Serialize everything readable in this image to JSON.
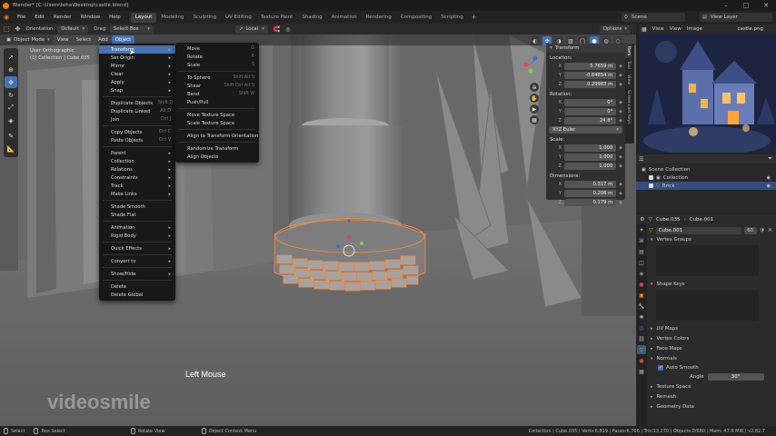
{
  "titlebar": {
    "title": "Blender* [C:\\Users\\teha\\Desktop\\castle.blend]"
  },
  "menubar": {
    "items": [
      "File",
      "Edit",
      "Render",
      "Window",
      "Help"
    ],
    "workspaces": [
      "Layout",
      "Modeling",
      "Sculpting",
      "UV Editing",
      "Texture Paint",
      "Shading",
      "Animation",
      "Rendering",
      "Compositing",
      "Scripting"
    ],
    "active_workspace": "Layout",
    "scene_label": "Scene",
    "view_layer_label": "View Layer"
  },
  "tool_header": {
    "orientation_label": "Orientation:",
    "orientation_value": "Default",
    "drag_label": "Drag:",
    "drag_value": "Select Box",
    "pivot_value": "Local",
    "options_label": "Options"
  },
  "viewport_header": {
    "mode": "Object Mode",
    "menus": [
      "View",
      "Select",
      "Add",
      "Object"
    ],
    "active_menu": "Object"
  },
  "viewport": {
    "view_name": "User Orthographic",
    "collection_info": "(1) Collection | Cube.035",
    "overlay_text": "Left Mouse",
    "watermark": "videosmile"
  },
  "object_menu": {
    "items": [
      {
        "label": "Transform",
        "shortcut": "",
        "sub": true,
        "hl": true
      },
      {
        "label": "Set Origin",
        "shortcut": "",
        "sub": true
      },
      {
        "label": "Mirror",
        "shortcut": "",
        "sub": true
      },
      {
        "label": "Clear",
        "shortcut": "",
        "sub": true
      },
      {
        "label": "Apply",
        "shortcut": "Ctrl A",
        "sub": true
      },
      {
        "label": "Snap",
        "shortcut": "",
        "sub": true
      },
      {
        "sep": true
      },
      {
        "label": "Duplicate Objects",
        "shortcut": "Shift D"
      },
      {
        "label": "Duplicate Linked",
        "shortcut": "Alt D"
      },
      {
        "label": "Join",
        "shortcut": "Ctrl J"
      },
      {
        "sep": true
      },
      {
        "label": "Copy Objects",
        "shortcut": "Ctrl C"
      },
      {
        "label": "Paste Objects",
        "shortcut": "Ctrl V"
      },
      {
        "sep": true
      },
      {
        "label": "Parent",
        "shortcut": "",
        "sub": true
      },
      {
        "label": "Collection",
        "shortcut": "",
        "sub": true
      },
      {
        "label": "Relations",
        "shortcut": "",
        "sub": true
      },
      {
        "label": "Constraints",
        "shortcut": "",
        "sub": true
      },
      {
        "label": "Track",
        "shortcut": "",
        "sub": true
      },
      {
        "label": "Make Links",
        "shortcut": "Ctrl L",
        "sub": true
      },
      {
        "sep": true
      },
      {
        "label": "Shade Smooth",
        "shortcut": ""
      },
      {
        "label": "Shade Flat",
        "shortcut": ""
      },
      {
        "sep": true
      },
      {
        "label": "Animation",
        "shortcut": "",
        "sub": true
      },
      {
        "label": "Rigid Body",
        "shortcut": "",
        "sub": true
      },
      {
        "sep": true
      },
      {
        "label": "Quick Effects",
        "shortcut": "",
        "sub": true
      },
      {
        "sep": true
      },
      {
        "label": "Convert to",
        "shortcut": "",
        "sub": true
      },
      {
        "sep": true
      },
      {
        "label": "Show/Hide",
        "shortcut": "",
        "sub": true
      },
      {
        "sep": true
      },
      {
        "label": "Delete",
        "shortcut": ""
      },
      {
        "label": "Delete Global",
        "shortcut": ""
      }
    ]
  },
  "transform_submenu": {
    "items": [
      {
        "label": "Move",
        "shortcut": "G"
      },
      {
        "label": "Rotate",
        "shortcut": "R"
      },
      {
        "label": "Scale",
        "shortcut": "S"
      },
      {
        "sep": true
      },
      {
        "label": "To Sphere",
        "shortcut": "Shift Alt S"
      },
      {
        "label": "Shear",
        "shortcut": "Shift Ctrl Alt S"
      },
      {
        "label": "Bend",
        "shortcut": "Shift W"
      },
      {
        "label": "Push/Pull",
        "shortcut": ""
      },
      {
        "sep": true
      },
      {
        "label": "Move Texture Space",
        "shortcut": ""
      },
      {
        "label": "Scale Texture Space",
        "shortcut": ""
      },
      {
        "sep": true
      },
      {
        "label": "Align to Transform Orientation",
        "shortcut": ""
      },
      {
        "sep": true
      },
      {
        "label": "Randomize Transform",
        "shortcut": ""
      },
      {
        "label": "Align Objects",
        "shortcut": ""
      }
    ]
  },
  "npanel": {
    "title": "Transform",
    "location_label": "Location:",
    "location": [
      {
        "axis": "X",
        "value": "5.7659 m"
      },
      {
        "axis": "Y",
        "value": "-0.84854 m"
      },
      {
        "axis": "Z",
        "value": "0.29983 m"
      }
    ],
    "rotation_label": "Rotation:",
    "rotation": [
      {
        "axis": "X",
        "value": "0°"
      },
      {
        "axis": "Y",
        "value": "0°"
      },
      {
        "axis": "Z",
        "value": "24.8°"
      }
    ],
    "rotation_mode": "XYZ Euler",
    "scale_label": "Scale:",
    "scale": [
      {
        "axis": "X",
        "value": "1.000"
      },
      {
        "axis": "Y",
        "value": "1.000"
      },
      {
        "axis": "Z",
        "value": "1.000"
      }
    ],
    "dimensions_label": "Dimensions:",
    "dimensions": [
      {
        "axis": "X",
        "value": "0.317 m"
      },
      {
        "axis": "Y",
        "value": "0.206 m"
      },
      {
        "axis": "Z",
        "value": "0.179 m"
      }
    ],
    "tabs": [
      "Item",
      "Tool",
      "View",
      "Screencast Keys"
    ]
  },
  "image_editor": {
    "menus": [
      "View",
      "View",
      "Image"
    ],
    "image_name": "castle.png"
  },
  "outliner": {
    "items": [
      {
        "label": "Scene Collection",
        "indent": 0
      },
      {
        "label": "Collection",
        "indent": 1
      },
      {
        "label": "Brick",
        "indent": 1
      }
    ]
  },
  "properties": {
    "object_name": "Cube.035",
    "data_name": "Cube.001",
    "mesh_name": "Cube.001",
    "users": "60",
    "sections": [
      "Vertex Groups",
      "Shape Keys",
      "UV Maps",
      "Vertex Colors",
      "Face Maps",
      "Normals"
    ],
    "auto_smooth_label": "Auto Smooth",
    "angle_label": "Angle",
    "angle_value": "30°",
    "more_sections": [
      "Texture Space",
      "Remesh",
      "Geometry Data"
    ]
  },
  "statusbar": {
    "items": [
      "Select",
      "Box Select",
      "Rotate View",
      "Object Context Menu"
    ],
    "stats": "Collection | Cube.035 | Verts:6,819 | Faces:6,766 | Tris:13,270 | Objects:0/680 | Mem: 47.6 MiB | v2.82.7"
  },
  "colors": {
    "accent": "#4772b3",
    "selection": "#ff8a3d",
    "bg": "#1d1d1d"
  }
}
